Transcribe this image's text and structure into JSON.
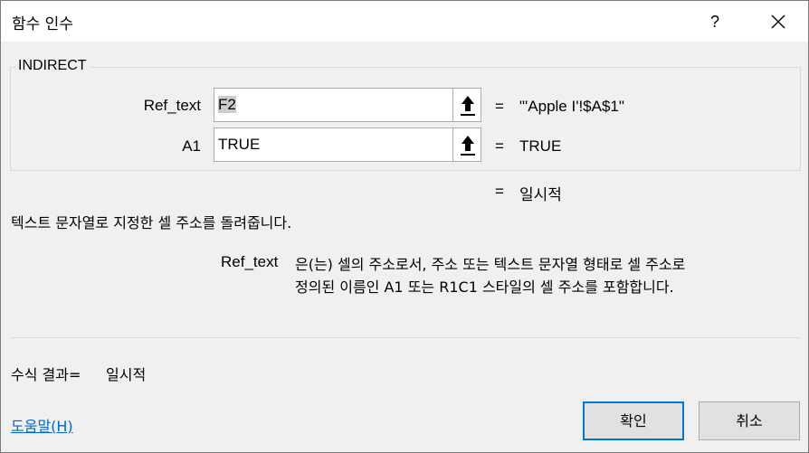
{
  "window": {
    "title": "함수 인수",
    "help_glyph": "?",
    "close_icon": "close-icon"
  },
  "function_name": "INDIRECT",
  "args": [
    {
      "label": "Ref_text",
      "input_value": "F2",
      "result_eq": "=",
      "result": "\"'Apple I'!$A$1\""
    },
    {
      "label": "A1",
      "input_value": "TRUE",
      "result_eq": "=",
      "result": "TRUE"
    }
  ],
  "function_result": {
    "eq": "=",
    "value": "일시적"
  },
  "description": "텍스트 문자열로 지정한 셀 주소를 돌려줍니다.",
  "param_help": {
    "name": "Ref_text",
    "line1": "은(는) 셀의 주소로서, 주소 또는 텍스트 문자열 형태로 셀 주소로",
    "line2": "정의된 이름인 A1 또는 R1C1 스타일의 셀 주소를 포함합니다."
  },
  "formula_result": {
    "label": "수식 결과=",
    "value": "일시적"
  },
  "help_link": "도움말(H)",
  "buttons": {
    "ok": "확인",
    "cancel": "취소"
  },
  "colors": {
    "dialog_bg": "#f0f0f0",
    "accent": "#0078d7",
    "link": "#0066cc"
  }
}
